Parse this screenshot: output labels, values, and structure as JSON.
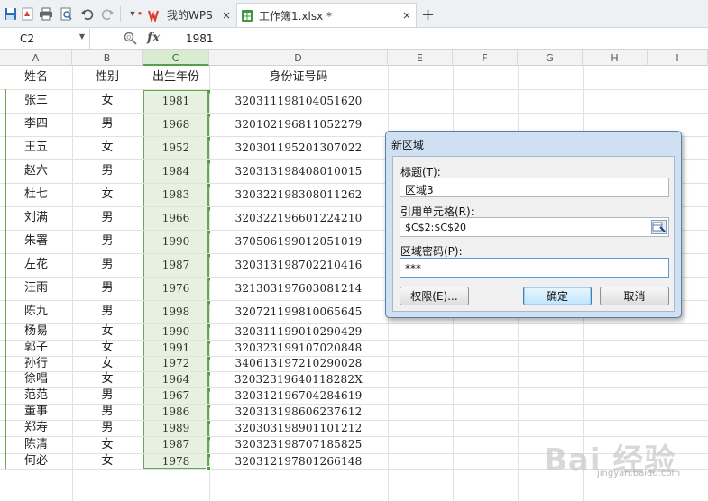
{
  "toolbar": {
    "icons": [
      "save-icon",
      "pdf-icon",
      "print-icon",
      "print-preview-icon",
      "undo-icon",
      "redo-icon",
      "more-icon",
      "pin-icon"
    ],
    "tabs": [
      {
        "label": "我的WPS",
        "close": "×"
      },
      {
        "label": "工作簿1.xlsx *",
        "close": "×"
      }
    ],
    "new_tab": "+"
  },
  "formula_bar": {
    "name_box": "C2",
    "fx_label": "fx",
    "content": "1981"
  },
  "columns": [
    "A",
    "B",
    "C",
    "D",
    "E",
    "F",
    "G",
    "H",
    "I"
  ],
  "selected_column": "C",
  "header_row": {
    "name": "姓名",
    "gender": "性别",
    "year": "出生年份",
    "id": "身份证号码"
  },
  "rows": [
    {
      "name": "张三",
      "gender": "女",
      "year": "1981",
      "id": "320311198104051620"
    },
    {
      "name": "李四",
      "gender": "男",
      "year": "1968",
      "id": "320102196811052279"
    },
    {
      "name": "王五",
      "gender": "女",
      "year": "1952",
      "id": "320301195201307022"
    },
    {
      "name": "赵六",
      "gender": "男",
      "year": "1984",
      "id": "320313198408010015"
    },
    {
      "name": "杜七",
      "gender": "女",
      "year": "1983",
      "id": "320322198308011262"
    },
    {
      "name": "刘满",
      "gender": "男",
      "year": "1966",
      "id": "320322196601224210"
    },
    {
      "name": "朱署",
      "gender": "男",
      "year": "1990",
      "id": "370506199012051019"
    },
    {
      "name": "左花",
      "gender": "男",
      "year": "1987",
      "id": "320313198702210416"
    },
    {
      "name": "汪雨",
      "gender": "男",
      "year": "1976",
      "id": "321303197603081214"
    },
    {
      "name": "陈九",
      "gender": "男",
      "year": "1998",
      "id": "320721199810065645"
    },
    {
      "name": "杨易",
      "gender": "女",
      "year": "1990",
      "id": "320311199010290429"
    },
    {
      "name": "郭子",
      "gender": "女",
      "year": "1991",
      "id": "320323199107020848"
    },
    {
      "name": "孙行",
      "gender": "女",
      "year": "1972",
      "id": "340613197210290028"
    },
    {
      "name": "徐唱",
      "gender": "女",
      "year": "1964",
      "id": "32032319640118282X"
    },
    {
      "name": "范范",
      "gender": "男",
      "year": "1967",
      "id": "320312196704284619"
    },
    {
      "name": "董事",
      "gender": "男",
      "year": "1986",
      "id": "320313198606237612"
    },
    {
      "name": "郑寿",
      "gender": "男",
      "year": "1989",
      "id": "320303198901101212"
    },
    {
      "name": "陈清",
      "gender": "女",
      "year": "1987",
      "id": "320323198707185825"
    },
    {
      "name": "何必",
      "gender": "女",
      "year": "1978",
      "id": "320312197801266148"
    }
  ],
  "dialog": {
    "title": "新区域",
    "title_label": "标题(T):",
    "title_value": "区域3",
    "ref_label": "引用单元格(R):",
    "ref_value": "$C$2:$C$20",
    "pwd_label": "区域密码(P):",
    "pwd_value": "***",
    "perm_button": "权限(E)...",
    "ok_button": "确定",
    "cancel_button": "取消"
  },
  "watermark": {
    "text": "Bai 经验",
    "url": "jingyan.baidu.com"
  },
  "colors": {
    "selection_fill": "#e6f2df",
    "selection_border": "#66a855",
    "dialog_frame": "#cfe0f3"
  }
}
